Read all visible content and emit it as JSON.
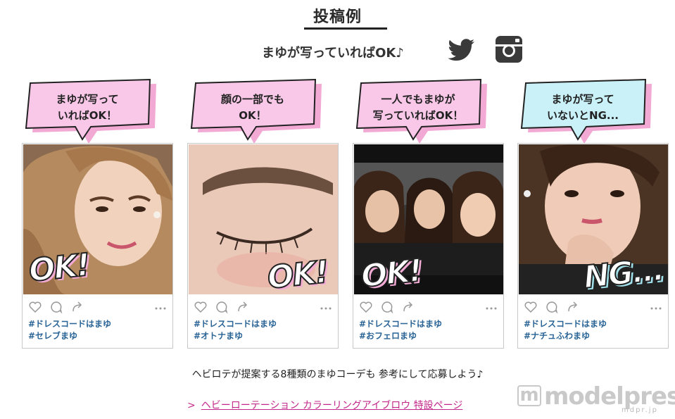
{
  "header": {
    "title": "投稿例",
    "subline": "まゆが写っていればOK♪"
  },
  "social": [
    "twitter-icon",
    "instagram-icon"
  ],
  "cards": [
    {
      "bubble_line1": "まゆが写って",
      "bubble_line2": "いればOK！",
      "bubble_color": "#f9c8e8",
      "stamp": "OK!",
      "tag1": "#ドレスコードはまゆ",
      "tag2": "#セレブまゆ"
    },
    {
      "bubble_line1": "顔の一部でも",
      "bubble_line2": "OK！",
      "bubble_color": "#f9c8e8",
      "stamp": "OK!",
      "tag1": "#ドレスコードはまゆ",
      "tag2": "#オトナまゆ"
    },
    {
      "bubble_line1": "一人でもまゆが",
      "bubble_line2": "写っていればOK！",
      "bubble_color": "#f9c8e8",
      "stamp": "OK!",
      "tag1": "#ドレスコードはまゆ",
      "tag2": "#おフェロまゆ"
    },
    {
      "bubble_line1": "まゆが写って",
      "bubble_line2": "いないとNG...",
      "bubble_color": "#c9f1f7",
      "stamp": "NG...",
      "tag1": "#ドレスコードはまゆ",
      "tag2": "#ナチュふわまゆ"
    }
  ],
  "cta": {
    "text": "ヘビロテが提案する8種類のまゆコーデも 参考にして応募しよう♪",
    "arrow": ">",
    "link_text": "ヘビーローテーション カラーリングアイブロウ 特設ページ"
  },
  "watermark": {
    "mark": "m",
    "brand": "modelpress",
    "sub": "mdpr.jp"
  },
  "colors": {
    "ok_shadow": "#f2a9d4",
    "ng_shadow": "#9fe0ea",
    "tag_text": "#2a6496",
    "link": "#c2288a"
  }
}
